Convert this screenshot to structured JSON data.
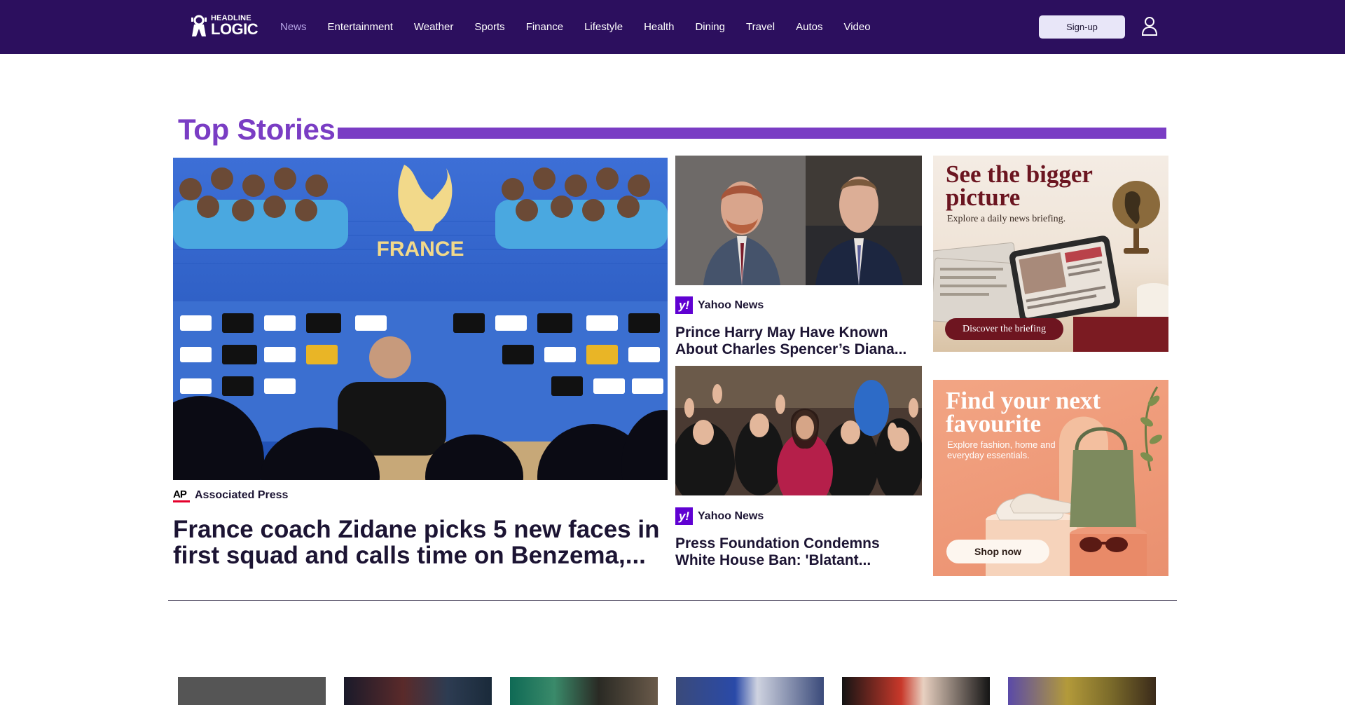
{
  "header": {
    "logo_line1": "HEADLINE",
    "logo_line2": "LOGIC",
    "nav": [
      "News",
      "Entertainment",
      "Weather",
      "Sports",
      "Finance",
      "Lifestyle",
      "Health",
      "Dining",
      "Travel",
      "Autos",
      "Video"
    ],
    "active_nav": "News",
    "signup_label": "Sign-up"
  },
  "top_stories": {
    "title": "Top Stories",
    "main": {
      "source": "Associated Press",
      "source_logo": "AP",
      "headline": "France coach Zidane picks 5 new faces in first squad and calls time on Benzema,..."
    },
    "side": [
      {
        "source": "Yahoo News",
        "source_logo": "y!",
        "headline": "Prince Harry May Have Known About Charles Spencer’s Diana..."
      },
      {
        "source": "Yahoo News",
        "source_logo": "y!",
        "headline": "Press Foundation Condemns White House Ban: 'Blatant..."
      }
    ]
  },
  "ads": [
    {
      "headline_line1": "See the bigger",
      "headline_line2": "picture",
      "subtext": "Explore a daily news briefing.",
      "button": "Discover the briefing"
    },
    {
      "headline_line1": "Find your next",
      "headline_line2": "favourite",
      "subtext_line1": "Explore fashion, home and",
      "subtext_line2": "everyday essentials.",
      "button": "Shop now"
    }
  ],
  "colors": {
    "header_bg": "#2c0f5e",
    "accent": "#7a3dc4",
    "active_nav": "#b9a8e8",
    "yahoo_purple": "#6001d2",
    "ap_red": "#e4002b"
  }
}
